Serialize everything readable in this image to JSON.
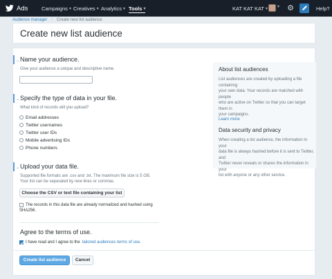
{
  "topbar": {
    "brand": "Ads",
    "nav": [
      {
        "label": "Campaigns"
      },
      {
        "label": "Creatives"
      },
      {
        "label": "Analytics"
      },
      {
        "label": "Tools",
        "active": true
      }
    ],
    "account": "KAT KAT KAT",
    "help": "Help?"
  },
  "breadcrumb": {
    "root": "Audience manager",
    "current": "Create new list audience"
  },
  "page_title": "Create new list audience",
  "name_section": {
    "title": "Name your audience.",
    "hint": "Give your audience a unique and descriptive name.",
    "input_value": ""
  },
  "type_section": {
    "title": "Specify the type of data in your file.",
    "hint": "What kind of records will you upload?",
    "options": [
      "Email addresses",
      "Twitter usernames",
      "Twitter user IDs",
      "Mobile advertising IDs",
      "Phone numbers"
    ]
  },
  "upload_section": {
    "title": "Upload your data file.",
    "hint_line1": "Supported file formats are .csv and .txt. The maximum file size is 5 GB.",
    "hint_line2": "Your list can be separated by new lines or commas.",
    "button": "Choose the CSV or text file containing your list",
    "checkbox_line1": "The records in this data file are already normalized and hashed using",
    "checkbox_line2": "SHA256."
  },
  "terms_section": {
    "title": "Agree to the terms of use.",
    "checkbox_prefix": "I have read and I agree to the",
    "checkbox_link": "tailored audiences terms of use.",
    "checked": true
  },
  "actions": {
    "primary": "Create list audience",
    "cancel": "Cancel"
  },
  "sidebar": {
    "about": {
      "title": "About list audiences",
      "lines": [
        "List audiences are created by uploading a file containing",
        "your own data. Your records are matched with people",
        "who are active on Twitter so that you can target them in",
        "your campaigns."
      ],
      "link": "Learn more"
    },
    "security": {
      "title": "Data security and privacy",
      "lines": [
        "When creating a list audience, the information in your",
        "data file is always hashed before it is sent to Twitter, and",
        "Twitter never reveals or shares the information in your",
        "list with anyone or any other service."
      ]
    }
  },
  "icons": {
    "brand": "twitter-bird-icon",
    "settings": "gear-icon",
    "compose": "compose-icon"
  }
}
